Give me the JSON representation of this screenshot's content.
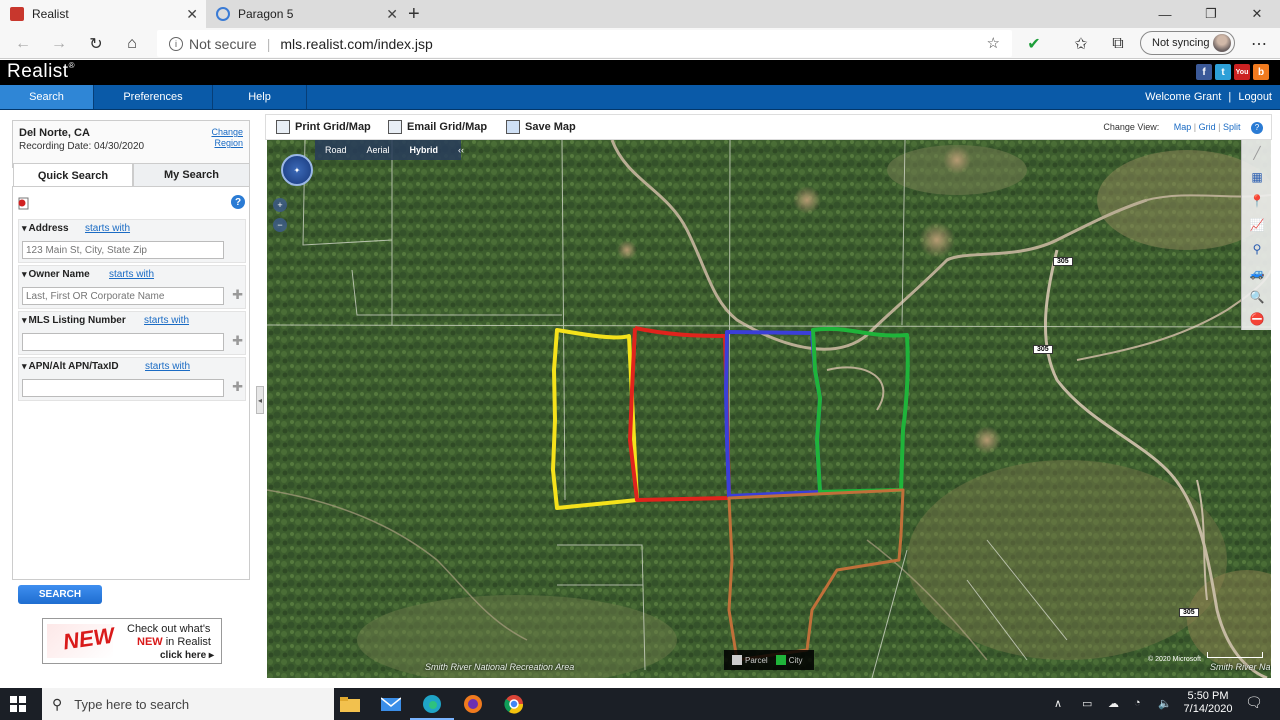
{
  "browser": {
    "tabs": [
      {
        "title": "Realist",
        "active": true
      },
      {
        "title": "Paragon 5",
        "active": false
      }
    ],
    "security_label": "Not secure",
    "url": "mls.realist.com/index.jsp",
    "sync_label": "Not syncing"
  },
  "app": {
    "logo": "Realist",
    "nav": [
      "Search",
      "Preferences",
      "Help"
    ],
    "welcome": "Welcome Grant",
    "logout": "Logout",
    "social": [
      "f",
      "t",
      "You",
      "b"
    ]
  },
  "region": {
    "name": "Del Norte, CA",
    "recording_date": "Recording Date: 04/30/2020",
    "change_line1": "Change",
    "change_line2": "Region"
  },
  "search": {
    "tabs": [
      "Quick Search",
      "My Search"
    ],
    "fields": [
      {
        "label": "Address",
        "mode": "starts with",
        "placeholder": "123 Main St, City, State Zip"
      },
      {
        "label": "Owner Name",
        "mode": "starts with",
        "placeholder": "Last, First OR Corporate Name"
      },
      {
        "label": "MLS Listing Number",
        "mode": "starts with",
        "placeholder": ""
      },
      {
        "label": "APN/Alt APN/TaxID",
        "mode": "starts with",
        "placeholder": ""
      }
    ],
    "button": "SEARCH"
  },
  "banner": {
    "badge": "NEW",
    "line1": "Check out what's",
    "line2_highlight": "NEW",
    "line2_rest": " in Realist",
    "cta": "click here ▸"
  },
  "map_toolbar": {
    "print": "Print Grid/Map",
    "email": "Email Grid/Map",
    "save": "Save Map",
    "change_view": "Change View:",
    "views": [
      "Map",
      "Grid",
      "Split"
    ]
  },
  "map": {
    "types": [
      "Road",
      "Aerial",
      "Hybrid"
    ],
    "selected_type": "Hybrid",
    "collapse": "‹‹",
    "road_labels": [
      "305",
      "305",
      "305"
    ],
    "area_labels": [
      "Smith River National Recreation Area",
      "Smith River Na"
    ],
    "legend": [
      "Parcel",
      "City"
    ],
    "copyright": "© 2020 Microsoft",
    "parcel_colors": {
      "yellow": "#f5e21b",
      "red": "#e0241c",
      "blue": "#3b3fd8",
      "green": "#1fb43a",
      "brown": "#c0703a"
    }
  },
  "taskbar": {
    "search_placeholder": "Type here to search",
    "time": "5:50 PM",
    "date": "7/14/2020"
  }
}
